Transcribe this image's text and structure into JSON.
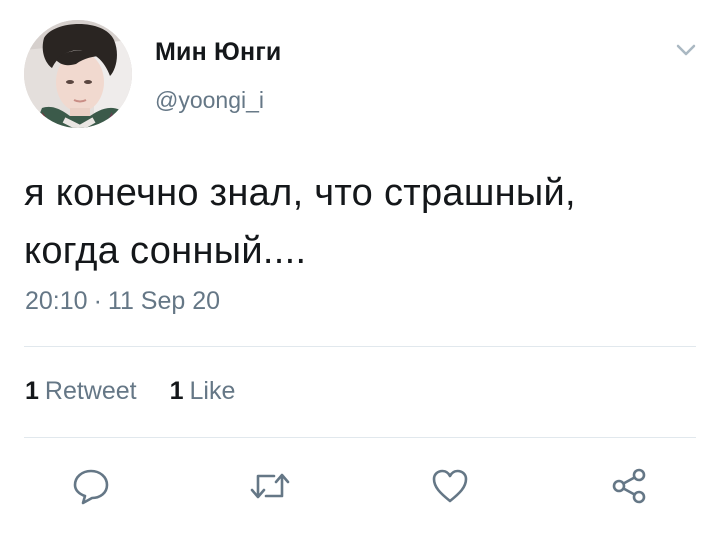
{
  "author": {
    "display_name": "Мин Юнги",
    "handle": "@yoongi_i"
  },
  "tweet": {
    "text_line1": "я конечно знал, что страшный,",
    "text_line2": "когда сонный....",
    "time": "20:10",
    "date": "11 Sep 20",
    "separator": "·"
  },
  "stats": {
    "retweet_count": "1",
    "retweet_label": "Retweet",
    "like_count": "1",
    "like_label": "Like"
  },
  "icons": {
    "menu": "chevron-down-icon",
    "reply": "reply-icon",
    "retweet": "retweet-icon",
    "like": "heart-icon",
    "share": "share-icon"
  },
  "colors": {
    "text": "#14171a",
    "secondary": "#657786",
    "divider": "#e1e8ed",
    "icon": "#657786"
  }
}
